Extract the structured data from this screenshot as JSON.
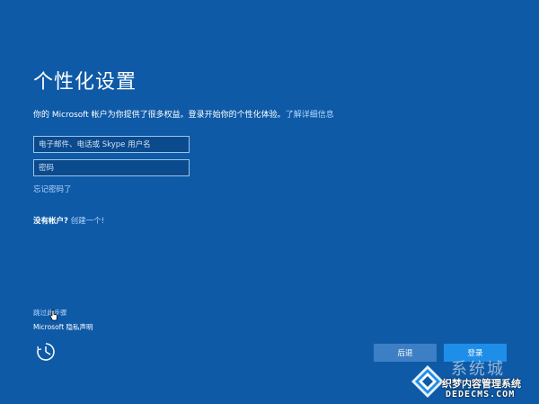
{
  "header": {
    "title": "个性化设置",
    "subtitle_text": "你的 Microsoft 帐户为你提供了很多权益。登录开始你的个性化体验。",
    "learn_more_link": "了解详细信息"
  },
  "form": {
    "email_placeholder": "电子邮件、电话或 Skype 用户名",
    "password_placeholder": "密码",
    "forgot_password": "忘记密码了"
  },
  "account": {
    "no_account_text": "没有帐户?",
    "create_link": "创建一个!"
  },
  "footer": {
    "skip_link": "跳过此步骤",
    "privacy_link": "Microsoft 隐私声明",
    "ease_of_access_icon": "ease-of-access-icon",
    "back_button": "后退",
    "login_button": "登录"
  },
  "watermark": {
    "brand": "系统城",
    "line1": "织梦内容管理系统",
    "line2": "DEDECMS.COM"
  },
  "colors": {
    "background": "#0e5aa7",
    "link": "#b3d8ff",
    "back_button": "#3d7fc4",
    "login_button": "#1f8ee8"
  }
}
